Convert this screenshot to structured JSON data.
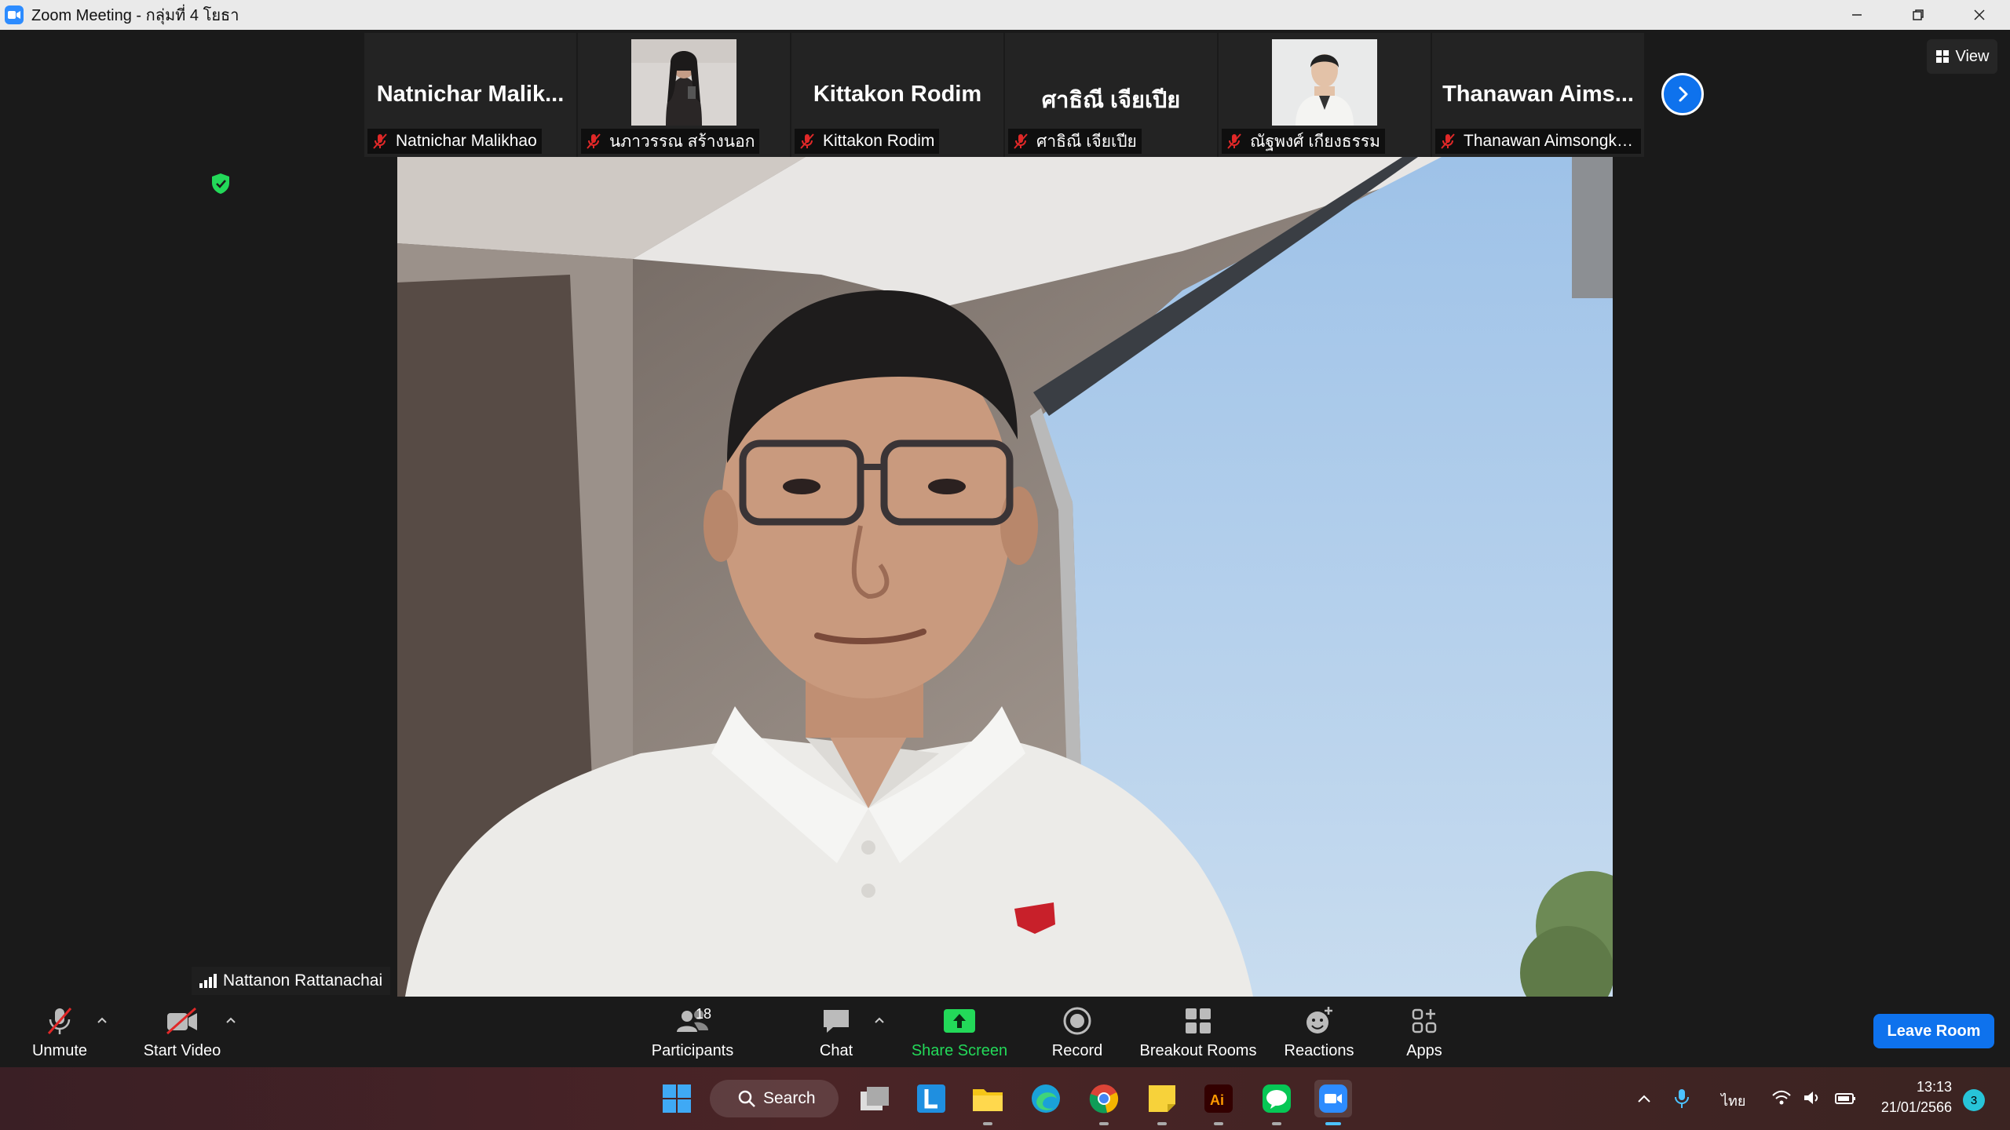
{
  "window": {
    "title": "Zoom Meeting - กลุ่มที่ 4 โยธา"
  },
  "participants_strip": [
    {
      "display_name": "Natnichar  Malik...",
      "label": "Natnichar Malikhao",
      "has_photo": false
    },
    {
      "display_name": "",
      "label": "นภาวรรณ  สร้างนอก",
      "has_photo": true
    },
    {
      "display_name": "Kittakon Rodim",
      "label": "Kittakon Rodim",
      "has_photo": false
    },
    {
      "display_name": "ศาธิณี  เจียเปีย",
      "label": "ศาธิณี  เจียเปีย",
      "has_photo": false
    },
    {
      "display_name": "",
      "label": "ณัฐพงศ์ เกียงธรรม",
      "has_photo": true
    },
    {
      "display_name": "Thanawan  Aims...",
      "label": "Thanawan Aimsongkra...",
      "has_photo": false
    }
  ],
  "view_button": "View",
  "active_speaker": "Nattanon Rattanachai",
  "toolbar": {
    "unmute": "Unmute",
    "start_video": "Start Video",
    "participants": "Participants",
    "participants_count": "18",
    "chat": "Chat",
    "share_screen": "Share Screen",
    "record": "Record",
    "breakout_rooms": "Breakout Rooms",
    "reactions": "Reactions",
    "apps": "Apps",
    "leave": "Leave Room"
  },
  "taskbar": {
    "search": "Search",
    "language": "ไทย",
    "time": "13:13",
    "date": "21/01/2566",
    "notifications": "3"
  },
  "colors": {
    "accent": "#0e72ed",
    "share_green": "#23d959",
    "mute_red": "#e02828"
  }
}
